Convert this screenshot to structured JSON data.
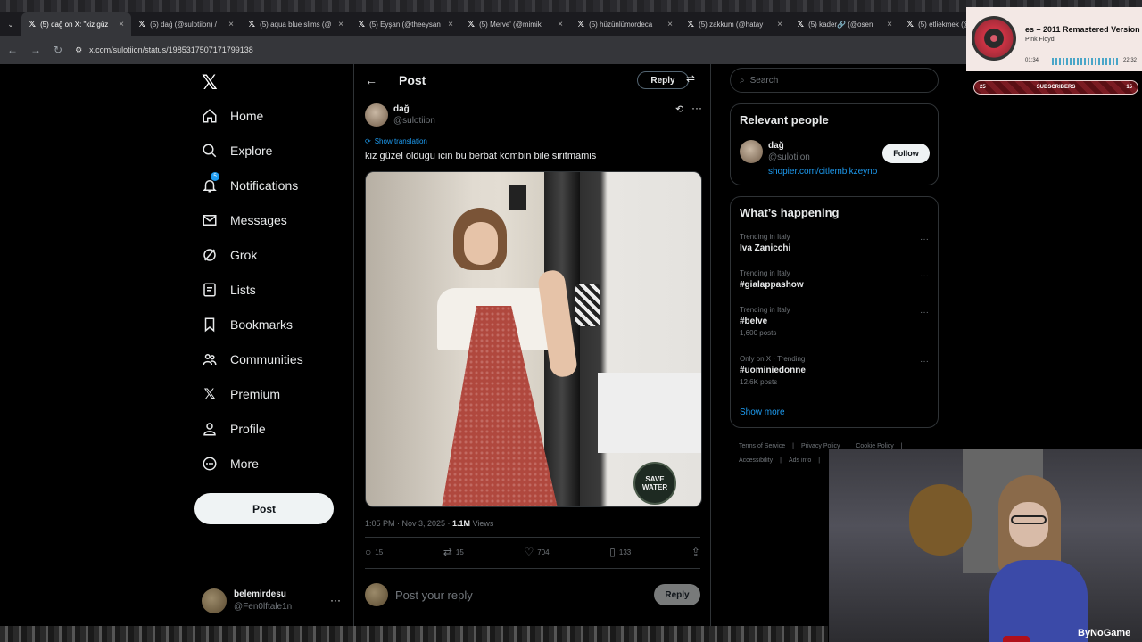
{
  "browser": {
    "tabs": [
      {
        "title": "(5) dağ on X: \"kiz güz",
        "active": true
      },
      {
        "title": "(5) dağ (@sulotiion) /",
        "active": false
      },
      {
        "title": "(5) aqua blue slims (@",
        "active": false
      },
      {
        "title": "(5) Eyşan (@theeysan",
        "active": false
      },
      {
        "title": "(5) Merve' (@mimik",
        "active": false
      },
      {
        "title": "(5) hüzünlümordeca",
        "active": false
      },
      {
        "title": "(5) zakkum (@hatay",
        "active": false
      },
      {
        "title": "(5) kader🔗 (@osen",
        "active": false
      },
      {
        "title": "(5) etliekmek (@",
        "active": false
      }
    ],
    "url": "x.com/sulotiion/status/1985317507171799138"
  },
  "sidebar": {
    "items": [
      {
        "label": "Home",
        "icon": "home-icon"
      },
      {
        "label": "Explore",
        "icon": "search-icon"
      },
      {
        "label": "Notifications",
        "icon": "bell-icon",
        "badge": "5"
      },
      {
        "label": "Messages",
        "icon": "mail-icon"
      },
      {
        "label": "Grok",
        "icon": "grok-icon"
      },
      {
        "label": "Lists",
        "icon": "list-icon"
      },
      {
        "label": "Bookmarks",
        "icon": "bookmark-icon"
      },
      {
        "label": "Communities",
        "icon": "people-icon"
      },
      {
        "label": "Premium",
        "icon": "x-premium-icon"
      },
      {
        "label": "Profile",
        "icon": "user-icon"
      },
      {
        "label": "More",
        "icon": "more-circle-icon"
      }
    ],
    "post_label": "Post",
    "account": {
      "name": "belemirdesu",
      "handle": "@Fen0lftale1n"
    }
  },
  "post": {
    "header_title": "Post",
    "reply_label": "Reply",
    "author_name": "dağ",
    "author_handle": "@sulotiion",
    "show_translation": "Show translation",
    "text": "kiz güzel oldugu icin bu berbat kombin  bile siritmamis",
    "media_badge": "SAVE WATER",
    "time": "1:05 PM · Nov 3, 2025 · ",
    "views": "1.1M",
    "views_label": " Views",
    "stats": {
      "replies": "15",
      "reposts": "15",
      "likes": "704",
      "bookmarks": "133"
    },
    "reply_placeholder": "Post your reply",
    "reply_button": "Reply"
  },
  "right": {
    "search_placeholder": "Search",
    "relevant": {
      "title": "Relevant people",
      "name": "dağ",
      "handle": "@sulotiion",
      "link": "shopier.com/citlemblkzeyno",
      "follow_label": "Follow"
    },
    "happening": {
      "title": "What’s happening",
      "trends": [
        {
          "context": "Trending in Italy",
          "title": "Iva Zanicchi",
          "count": ""
        },
        {
          "context": "Trending in Italy",
          "title": "#gialappashow",
          "count": ""
        },
        {
          "context": "Trending in Italy",
          "title": "#belve",
          "count": "1,600 posts"
        },
        {
          "context": "Only on X · Trending",
          "title": "#uominiedonne",
          "count": "12.6K posts"
        }
      ],
      "show_more": "Show more"
    },
    "footer": [
      "Terms of Service",
      "|",
      "Privacy Policy",
      "|",
      "Cookie Policy",
      "|",
      "Accessibility",
      "|",
      "Ads info",
      "|"
    ]
  },
  "overlay": {
    "song": "es – 2011 Remastered Version",
    "artist": "Pink Floyd",
    "elapsed": "01:34",
    "total": "22:32",
    "subs_left": "25",
    "subs_label": "SUBSCRIBERS",
    "subs_right": "15",
    "watermark": "ByNoGame"
  },
  "colors": {
    "accent": "#1d9bf0",
    "background": "#000000",
    "text": "#e7e9ea",
    "muted": "#71767b"
  }
}
